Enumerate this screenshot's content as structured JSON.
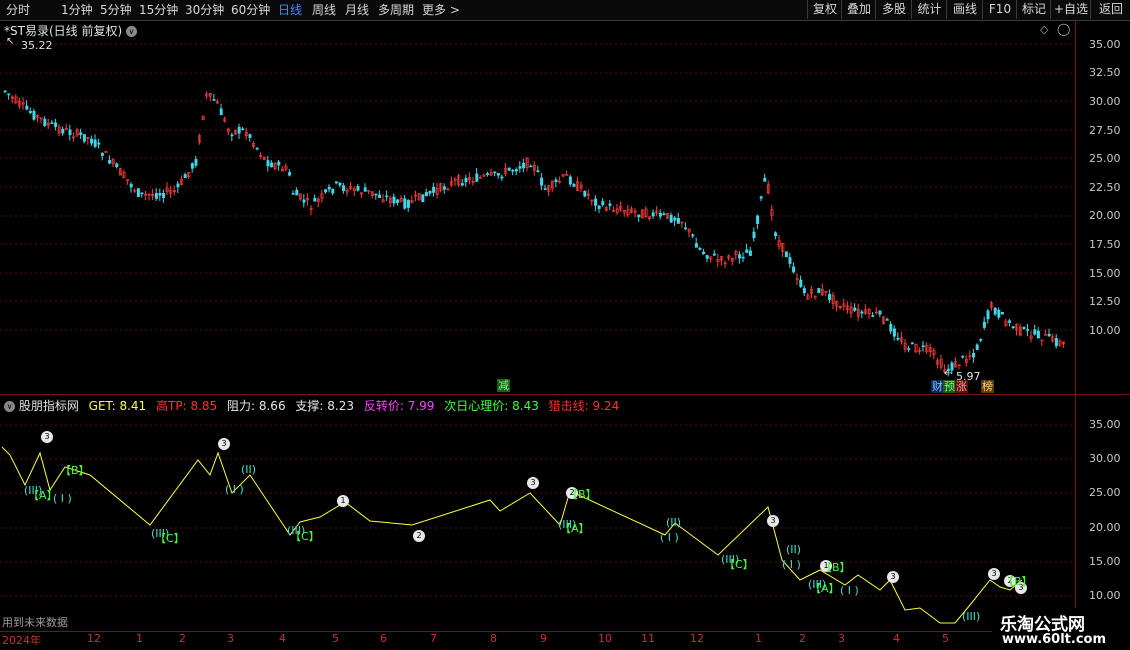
{
  "toolbar": {
    "timeframes": [
      "分时",
      "1分钟",
      "5分钟",
      "15分钟",
      "30分钟",
      "60分钟",
      "日线",
      "周线",
      "月线",
      "多周期",
      "更多"
    ],
    "active_timeframe": "日线",
    "more_arrow": ">",
    "buttons": [
      "复权",
      "叠加",
      "多股",
      "统计",
      "画线",
      "F10",
      "标记",
      "+自选",
      "返回"
    ]
  },
  "chart": {
    "title": "*ST易录(日线 前复权)",
    "high_label": "35.22",
    "low_label": "5.97",
    "y_labels": [
      "35.00",
      "32.50",
      "30.00",
      "27.50",
      "25.00",
      "22.50",
      "20.00",
      "17.50",
      "15.00",
      "12.50",
      "10.00"
    ],
    "markers": {
      "jian": "减",
      "caibao": "财",
      "yu": "预",
      "zhang": "涨",
      "bang": "榜"
    }
  },
  "indicator": {
    "name": "股朋指标网",
    "items": [
      {
        "label": "GET:",
        "value": "8.41",
        "color": "#ffff40"
      },
      {
        "label": "高TP:",
        "value": "8.85",
        "color": "#ff3030"
      },
      {
        "label": "阻力:",
        "value": "8.66",
        "color": "#e8e8e8"
      },
      {
        "label": "支撑:",
        "value": "8.23",
        "color": "#e8e8e8"
      },
      {
        "label": "反转价:",
        "value": "7.99",
        "color": "#ff40ff"
      },
      {
        "label": "次日心理价:",
        "value": "8.43",
        "color": "#40ff40"
      },
      {
        "label": "猎击线:",
        "value": "9.24",
        "color": "#ff3030"
      }
    ],
    "y_labels": [
      "35.00",
      "30.00",
      "25.00",
      "20.00",
      "15.00",
      "10.00"
    ],
    "future_note": "用到未来数据"
  },
  "xaxis": {
    "labels": [
      "2024年",
      "12",
      "1",
      "2",
      "3",
      "4",
      "5",
      "6",
      "7",
      "8",
      "9",
      "10",
      "11",
      "12",
      "1",
      "2",
      "3",
      "4",
      "5"
    ]
  },
  "watermark": {
    "title": "乐淘公式网",
    "url": "www.60lt.com"
  }
}
